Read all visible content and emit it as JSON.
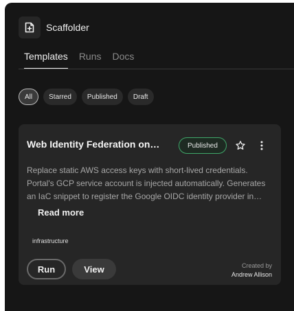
{
  "app": {
    "title": "Scaffolder",
    "icon": "file-plus-icon"
  },
  "tabs": [
    {
      "label": "Templates",
      "active": true
    },
    {
      "label": "Runs",
      "active": false
    },
    {
      "label": "Docs",
      "active": false
    }
  ],
  "filters": [
    {
      "label": "All",
      "active": true
    },
    {
      "label": "Starred",
      "active": false
    },
    {
      "label": "Published",
      "active": false
    },
    {
      "label": "Draft",
      "active": false
    }
  ],
  "card": {
    "title": "Web Identity Federation on…",
    "status": "Published",
    "status_color": "#3fa86a",
    "description": "Replace static AWS access keys with short-lived credentials. Portal's GCP service account is injected automatically. Generates an IaC snippet to register the Google OIDC identity provider in…",
    "read_more_label": "Read more",
    "tag": "infrastructure",
    "run_label": "Run",
    "view_label": "View",
    "created_by_label": "Created by",
    "created_by_name": "Andrew Allison"
  },
  "colors": {
    "background": "#161616",
    "card": "#262626",
    "accent_green": "#3fa86a"
  }
}
